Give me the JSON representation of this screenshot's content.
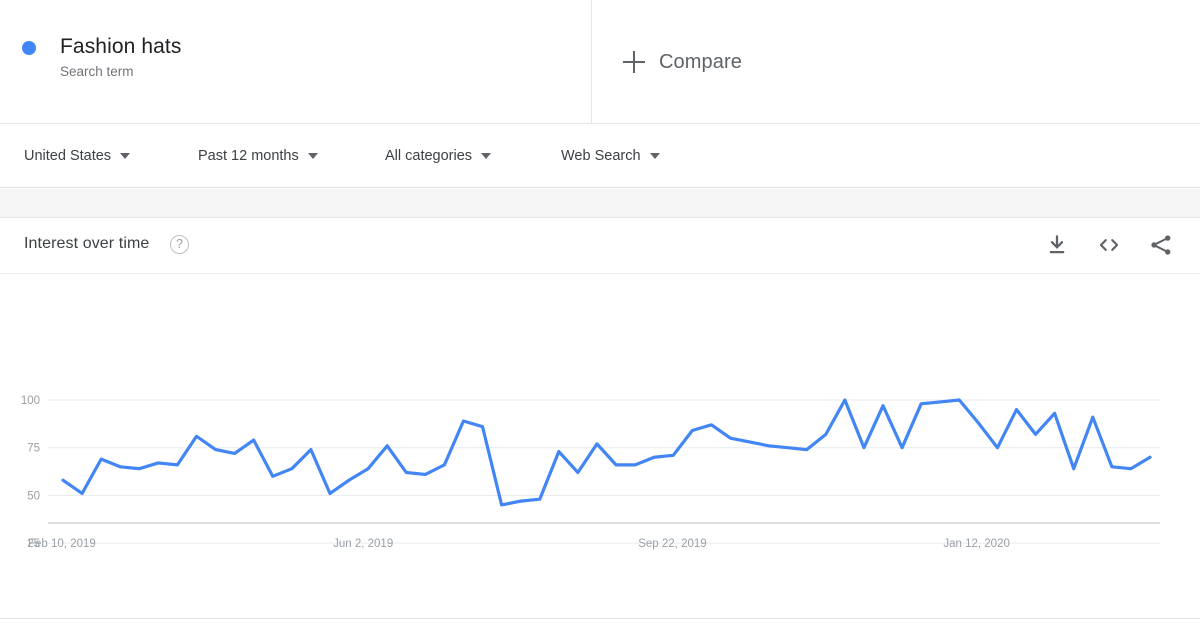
{
  "terms": [
    {
      "title": "Fashion hats",
      "subtitle": "Search term",
      "color": "#4285f4"
    }
  ],
  "compare": {
    "label": "Compare",
    "icon": "plus-icon"
  },
  "filters": [
    {
      "name": "region",
      "value": "United States"
    },
    {
      "name": "time-range",
      "value": "Past 12 months"
    },
    {
      "name": "category",
      "value": "All categories"
    },
    {
      "name": "search-type",
      "value": "Web Search"
    }
  ],
  "card": {
    "title": "Interest over time",
    "help_icon": "?",
    "actions": [
      {
        "name": "download-icon",
        "title": "Download"
      },
      {
        "name": "embed-icon",
        "title": "Embed"
      },
      {
        "name": "share-icon",
        "title": "Share"
      }
    ]
  },
  "chart_data": {
    "type": "line",
    "title": "Interest over time",
    "xlabel": "",
    "ylabel": "",
    "ylim": [
      0,
      105
    ],
    "yticks": [
      25,
      50,
      75,
      100
    ],
    "grid": true,
    "legend": false,
    "line_color": "#4285f4",
    "line_width": 3.2,
    "xticks": [
      "Feb 10, 2019",
      "Jun 2, 2019",
      "Sep 22, 2019",
      "Jan 12, 2020"
    ],
    "xtick_positions": [
      0,
      16,
      32,
      48
    ],
    "series": [
      {
        "name": "Fashion hats",
        "color": "#4285f4",
        "values": [
          58,
          51,
          69,
          65,
          64,
          67,
          66,
          81,
          74,
          72,
          79,
          60,
          64,
          74,
          51,
          58,
          64,
          76,
          62,
          61,
          66,
          89,
          86,
          45,
          47,
          48,
          73,
          62,
          77,
          66,
          66,
          70,
          71,
          84,
          87,
          80,
          78,
          76,
          75,
          74,
          82,
          100,
          75,
          97,
          75,
          98,
          99,
          100,
          88,
          75,
          95,
          82,
          93,
          64,
          91,
          65,
          64,
          70
        ]
      }
    ]
  }
}
